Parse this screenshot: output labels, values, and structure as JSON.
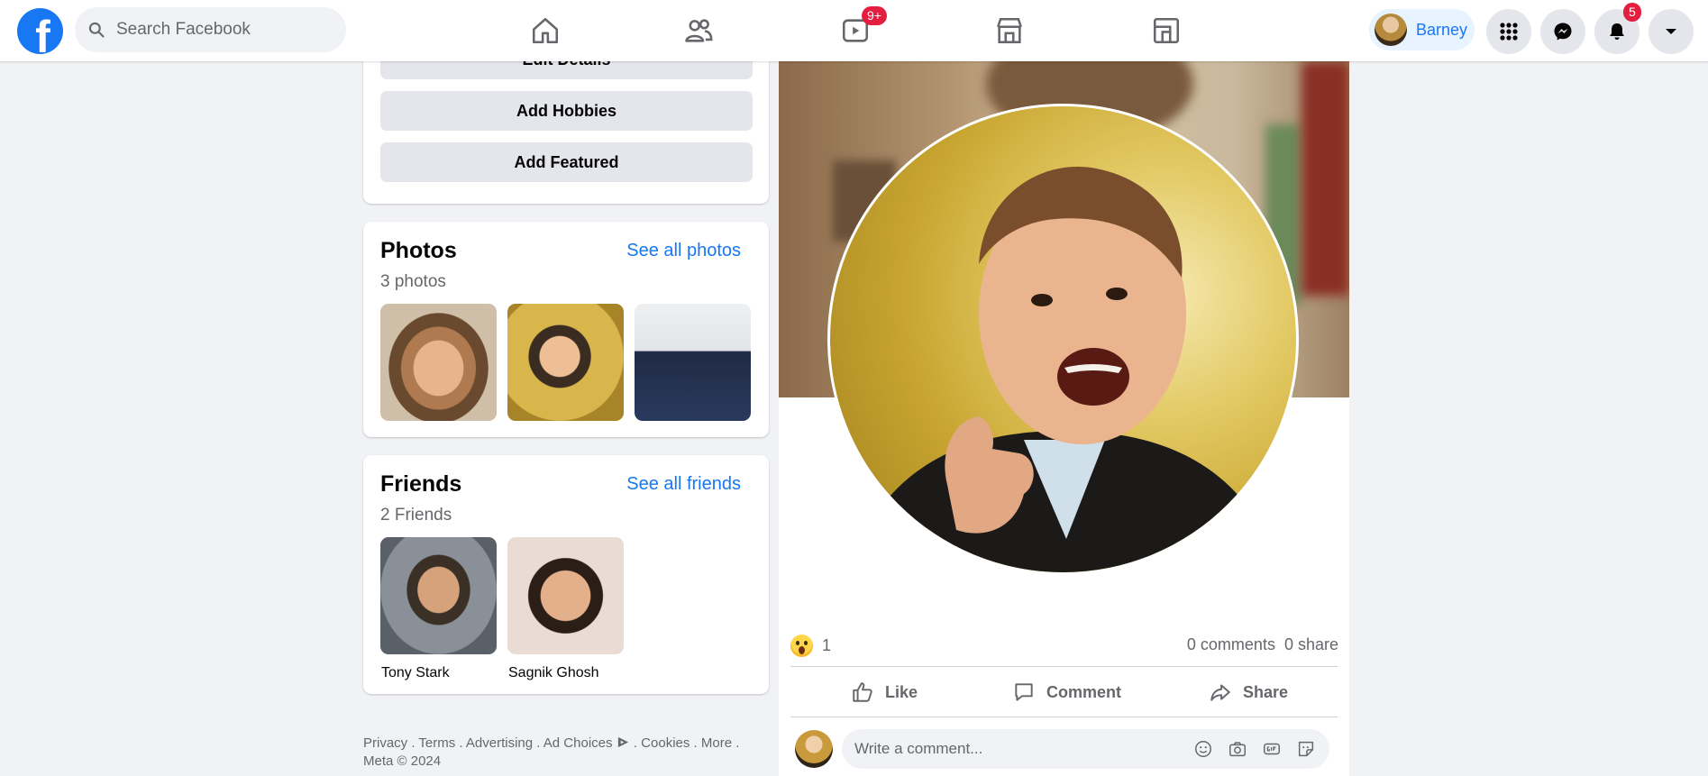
{
  "header": {
    "logo_letter": "f",
    "search_placeholder": "Search Facebook",
    "watch_badge": "9+",
    "profile_name": "Barney",
    "notifications_badge": "5"
  },
  "intro_buttons": {
    "edit_details": "Edit Details",
    "add_hobbies": "Add Hobbies",
    "add_featured": "Add Featured"
  },
  "photos": {
    "title": "Photos",
    "see_all": "See all photos",
    "count": "3 photos"
  },
  "friends": {
    "title": "Friends",
    "see_all": "See all friends",
    "count": "2 Friends",
    "items": [
      {
        "name": "Tony Stark"
      },
      {
        "name": "Sagnik Ghosh"
      }
    ]
  },
  "footer": {
    "links": "Privacy . Terms . Advertising . Ad Choices",
    "links2": ". Cookies . More .",
    "copyright": "Meta © 2024"
  },
  "post": {
    "reaction_count": "1",
    "comments": "0 comments",
    "shares": "0 share",
    "like": "Like",
    "comment": "Comment",
    "share": "Share",
    "comment_placeholder": "Write a comment..."
  },
  "colors": {
    "brand": "#1877f2",
    "badge": "#e41e3f",
    "background": "#f0f2f5"
  }
}
